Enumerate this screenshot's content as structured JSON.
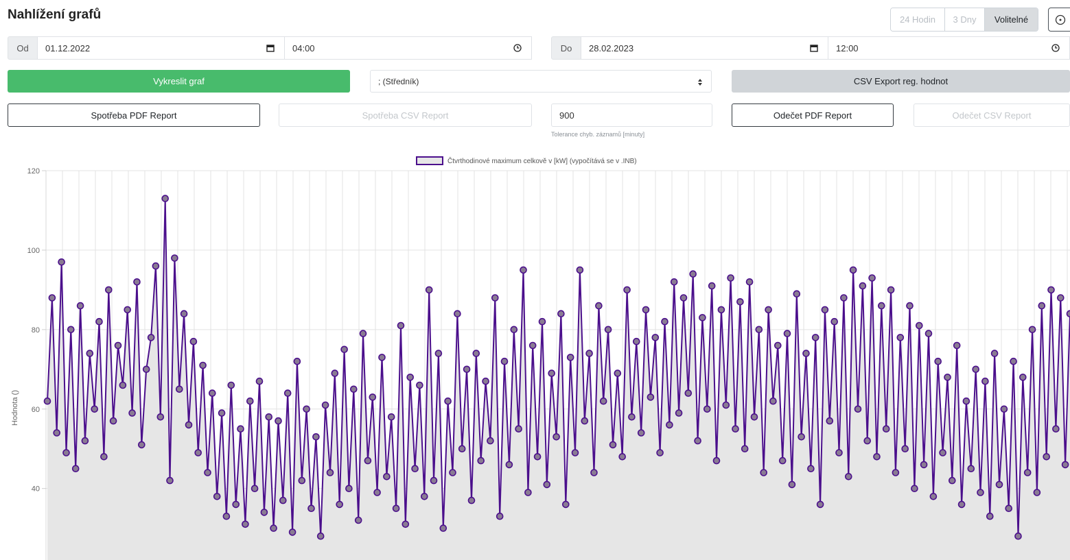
{
  "header": {
    "title": "Nahlížení grafů"
  },
  "range": {
    "options": [
      {
        "label": "24 Hodin",
        "active": false
      },
      {
        "label": "3 Dny",
        "active": false
      },
      {
        "label": "Volitelné",
        "active": true
      }
    ]
  },
  "from": {
    "addon": "Od",
    "date": "01.12.2022",
    "time": "04:00"
  },
  "to": {
    "addon": "Do",
    "date": "28.02.2023",
    "time": "12:00"
  },
  "actions": {
    "plot_label": "Vykreslit graf",
    "separator_value": "; (Středník)",
    "csv_export_label": "CSV Export reg. hodnot",
    "consumption_pdf_label": "Spotřeba PDF Report",
    "consumption_csv_label": "Spotřeba CSV Report",
    "tolerance_value": "900",
    "tolerance_help": "Tolerance chyb. záznamů [minuty]",
    "reading_pdf_label": "Odečet PDF Report",
    "reading_csv_label": "Odečet CSV Report"
  },
  "colors": {
    "accent_green": "#48bb6c",
    "series_line": "#4b0f8c",
    "series_point": "#8a7b93",
    "area_fill": "#e6e6e6"
  },
  "chart_data": {
    "type": "line",
    "legend": "Čtvrthodinové maximum celkově v [kW] (vypočítává se v .INB)",
    "ylabel": "Hodnota ()",
    "yticks": [
      40,
      60,
      80,
      100,
      120
    ],
    "ylim": [
      22,
      120
    ],
    "grid": true,
    "legend_position": "top-center",
    "series": [
      {
        "values": [
          62,
          88,
          54,
          97,
          49,
          80,
          45,
          86,
          52,
          74,
          60,
          82,
          48,
          90,
          57,
          76,
          66,
          85,
          59,
          92,
          51,
          70,
          78,
          96,
          58,
          113,
          42,
          98,
          65,
          84,
          56,
          77,
          49,
          71,
          44,
          64,
          38,
          59,
          33,
          66,
          36,
          55,
          31,
          62,
          40,
          67,
          34,
          58,
          30,
          57,
          37,
          64,
          29,
          72,
          42,
          60,
          35,
          53,
          28,
          61,
          44,
          69,
          36,
          75,
          40,
          65,
          32,
          79,
          47,
          63,
          39,
          73,
          43,
          58,
          35,
          81,
          31,
          68,
          45,
          66,
          38,
          90,
          42,
          74,
          30,
          62,
          44,
          84,
          50,
          70,
          37,
          74,
          47,
          67,
          52,
          88,
          33,
          72,
          46,
          80,
          55,
          95,
          39,
          76,
          48,
          82,
          41,
          69,
          53,
          84,
          36,
          73,
          49,
          95,
          57,
          74,
          44,
          86,
          62,
          80,
          51,
          69,
          48,
          90,
          58,
          77,
          54,
          85,
          63,
          78,
          49,
          82,
          56,
          92,
          59,
          88,
          64,
          94,
          52,
          83,
          60,
          91,
          47,
          85,
          61,
          93,
          55,
          87,
          50,
          92,
          58,
          80,
          44,
          85,
          62,
          76,
          47,
          79,
          41,
          89,
          53,
          74,
          45,
          78,
          36,
          85,
          57,
          82,
          49,
          88,
          43,
          95,
          60,
          91,
          52,
          93,
          48,
          86,
          55,
          90,
          44,
          78,
          50,
          86,
          40,
          81,
          46,
          79,
          38,
          72,
          49,
          68,
          42,
          76,
          36,
          62,
          45,
          70,
          39,
          67,
          33,
          74,
          41,
          60,
          35,
          72,
          28,
          68,
          44,
          80,
          39,
          86,
          48,
          90,
          55,
          88,
          46,
          84
        ]
      }
    ]
  }
}
